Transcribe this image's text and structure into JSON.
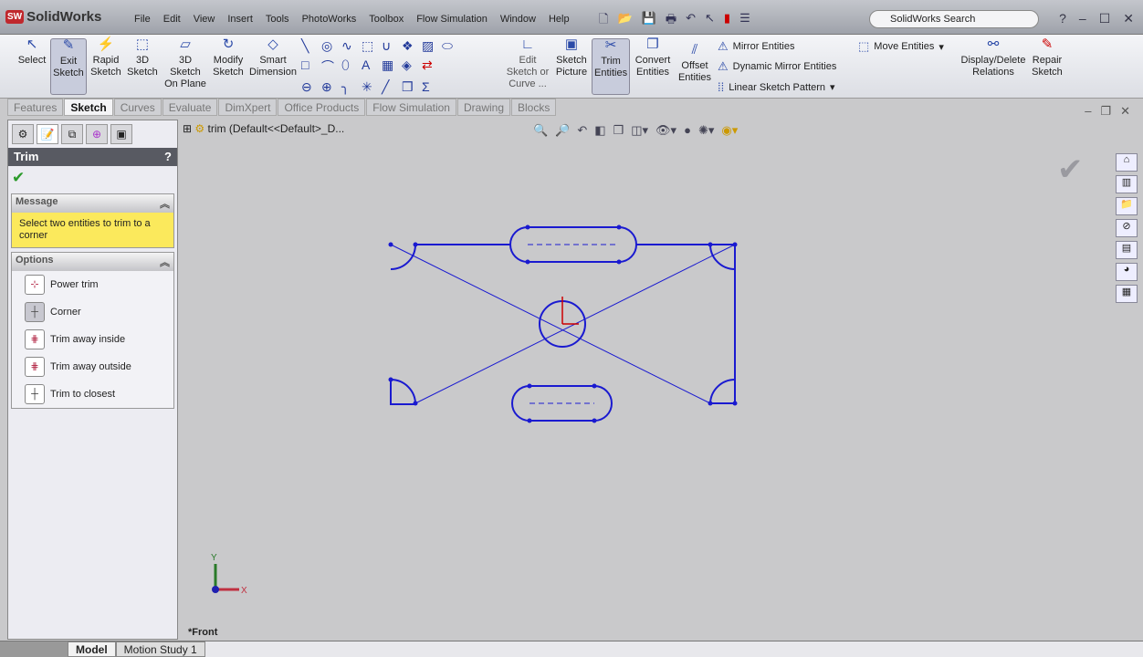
{
  "app": {
    "name": "SolidWorks",
    "search_placeholder": "SolidWorks Search"
  },
  "menu": [
    "File",
    "Edit",
    "View",
    "Insert",
    "Tools",
    "PhotoWorks",
    "Toolbox",
    "Flow Simulation",
    "Window",
    "Help"
  ],
  "ribbon": {
    "select": "Select",
    "exit_sketch": "Exit Sketch",
    "rapid_sketch": "Rapid Sketch",
    "sketch3d": "3D Sketch",
    "sketch3d_plane": "3D Sketch On Plane",
    "modify_sketch": "Modify Sketch",
    "smart_dimension": "Smart Dimension",
    "edit_sketch": "Edit Sketch or Curve ...",
    "sketch_picture": "Sketch Picture",
    "trim_entities": "Trim Entities",
    "convert_entities": "Convert Entities",
    "offset_entities": "Offset Entities",
    "mirror_entities": "Mirror Entities",
    "dynamic_mirror": "Dynamic Mirror Entities",
    "linear_pattern": "Linear Sketch Pattern",
    "move_entities": "Move Entities",
    "display_delete": "Display/Delete Relations",
    "repair_sketch": "Repair Sketch"
  },
  "tabs": [
    "Features",
    "Sketch",
    "Curves",
    "Evaluate",
    "DimXpert",
    "Office Products",
    "Flow Simulation",
    "Drawing",
    "Blocks"
  ],
  "property_manager": {
    "title": "Trim",
    "help": "?",
    "message_header": "Message",
    "message": "Select two entities to trim to a corner",
    "options_header": "Options",
    "options": [
      "Power trim",
      "Corner",
      "Trim away inside",
      "Trim away outside",
      "Trim to closest"
    ]
  },
  "tree": {
    "label": "trim  (Default<<Default>_D..."
  },
  "view": {
    "name": "*Front",
    "axis_x": "X",
    "axis_y": "Y"
  },
  "bottom_tabs": [
    "Model",
    "Motion Study 1"
  ],
  "colors": {
    "sketch": "#1a1ad0",
    "message_bg": "#fbe95c"
  }
}
